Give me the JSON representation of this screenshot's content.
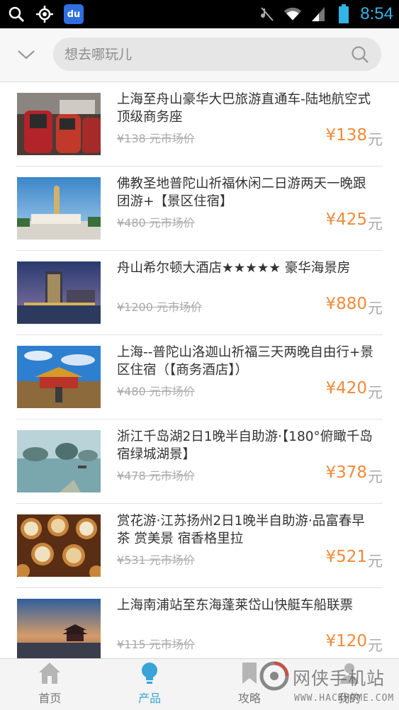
{
  "status_bar": {
    "time": "8:54",
    "baidu_badge": "du"
  },
  "search": {
    "placeholder": "想去哪玩儿"
  },
  "products": [
    {
      "title": "上海至舟山豪华大巴旅游直通车-陆地航空式顶级商务座",
      "original_price": "¥138 元市场价",
      "price": "¥138",
      "unit": "元",
      "image": "bus-interior"
    },
    {
      "title": "佛教圣地普陀山祈福休闲二日游两天一晚跟团游+【景区住宿】",
      "original_price": "¥480 元市场价",
      "price": "¥425",
      "unit": "元",
      "image": "buddha-statue"
    },
    {
      "title": "舟山希尔顿大酒店★★★★★ 豪华海景房",
      "original_price": "¥1200 元市场价",
      "price": "¥880",
      "unit": "元",
      "image": "hotel-night"
    },
    {
      "title": "上海--普陀山洛迦山祈福三天两晚自由行+景区住宿（【商务酒店】）",
      "original_price": "¥480 元市场价",
      "price": "¥420",
      "unit": "元",
      "image": "temple"
    },
    {
      "title": "浙江千岛湖2日1晚半自助游·【180°俯瞰千岛 宿绿城湖景】",
      "original_price": "¥478 元市场价",
      "price": "¥378",
      "unit": "元",
      "image": "lake-islands"
    },
    {
      "title": "赏花游·江苏扬州2日1晚半自助游·品富春早茶 赏美景 宿香格里拉",
      "original_price": "¥531 元市场价",
      "price": "¥521",
      "unit": "元",
      "image": "dim-sum"
    },
    {
      "title": "上海南浦站至东海蓬莱岱山快艇车船联票",
      "original_price": "¥115 元市场价",
      "price": "¥120",
      "unit": "元",
      "image": "pavilion-sunset"
    }
  ],
  "nav": {
    "home": "首页",
    "products": "产品",
    "guides": "攻略",
    "mine": "我的"
  },
  "watermark": {
    "name": "网侠手机站",
    "url": "WWW.HACKHOME.COM"
  },
  "colors": {
    "accent": "#3aa3d8",
    "price": "#f08a3a",
    "clock": "#33b5e5"
  }
}
